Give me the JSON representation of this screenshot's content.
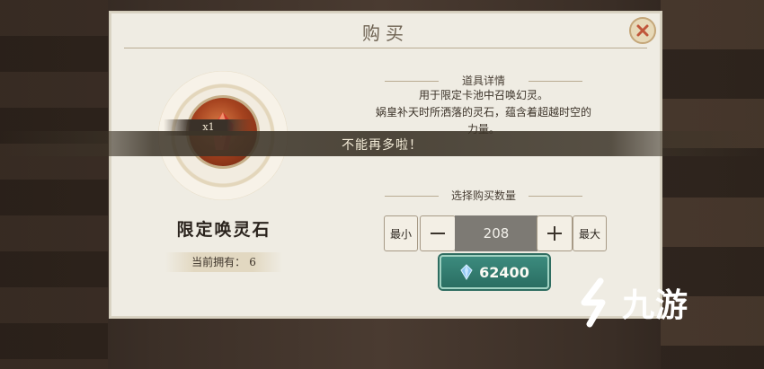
{
  "dialog": {
    "title": "购买",
    "close_icon": "close-x-icon"
  },
  "item": {
    "name": "限定唤灵石",
    "quantity_tag": "x1",
    "owned_label": "当前拥有：",
    "owned_value": "6",
    "icon": "spirit-stone-gem-icon"
  },
  "details": {
    "heading": "道具详情",
    "lines": [
      "用于限定卡池中召唤幻灵。",
      "娲皇补天时所洒落的灵石，蕴含着超越时空的",
      "力量。"
    ]
  },
  "toast": "不能再多啦！",
  "purchase": {
    "heading": "选择购买数量",
    "min_label": "最小",
    "max_label": "最大",
    "minus_icon": "minus-icon",
    "plus_icon": "plus-icon",
    "quantity": "208",
    "price": "62400",
    "currency_icon": "crystal-icon"
  },
  "watermark": {
    "text": "九游",
    "icon": "jiuyou-logo-icon"
  },
  "colors": {
    "buy_button": "#2f7a6d",
    "dialog_bg": "#efece3",
    "toast_bg": "#3c3428"
  }
}
